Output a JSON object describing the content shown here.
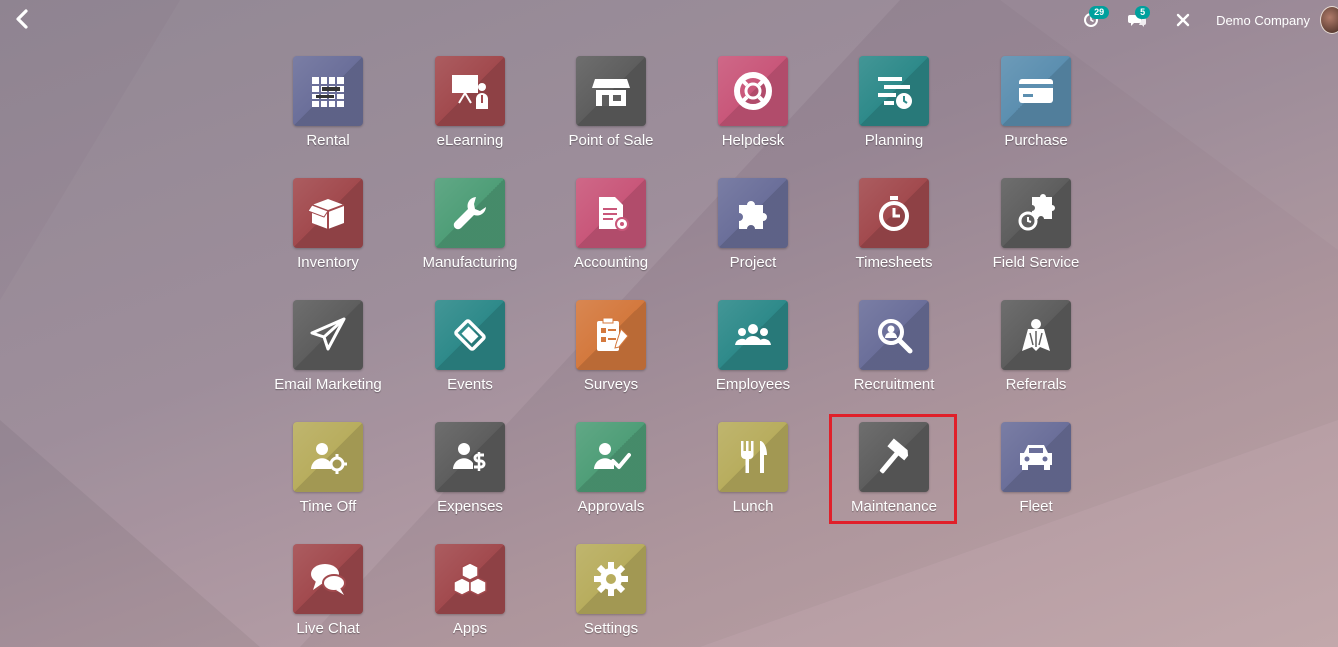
{
  "topbar": {
    "activity_count": "29",
    "messages_count": "5",
    "company_name": "Demo Company"
  },
  "colors": {
    "badge": "#00a09d",
    "highlight": "#e0202a"
  },
  "apps": [
    {
      "label": "Rental",
      "icon": "calendar-grid-icon",
      "color": "#6b6f9a"
    },
    {
      "label": "eLearning",
      "icon": "presentation-icon",
      "color": "#a24a4e"
    },
    {
      "label": "Point of Sale",
      "icon": "store-icon",
      "color": "#5e5e5e"
    },
    {
      "label": "Helpdesk",
      "icon": "lifebuoy-icon",
      "color": "#c9577a"
    },
    {
      "label": "Planning",
      "icon": "planning-icon",
      "color": "#2e8a8a"
    },
    {
      "label": "Purchase",
      "icon": "credit-card-icon",
      "color": "#5c8fb0"
    },
    {
      "label": "Inventory",
      "icon": "box-icon",
      "color": "#a24a4e"
    },
    {
      "label": "Manufacturing",
      "icon": "wrench-icon",
      "color": "#4f9e78"
    },
    {
      "label": "Accounting",
      "icon": "invoice-icon",
      "color": "#c9577a"
    },
    {
      "label": "Project",
      "icon": "puzzle-icon",
      "color": "#6b6f9a"
    },
    {
      "label": "Timesheets",
      "icon": "stopwatch-icon",
      "color": "#a24a4e"
    },
    {
      "label": "Field Service",
      "icon": "field-service-icon",
      "color": "#5e5e5e"
    },
    {
      "label": "Email Marketing",
      "icon": "paper-plane-icon",
      "color": "#5e5e5e"
    },
    {
      "label": "Events",
      "icon": "ticket-icon",
      "color": "#2e8a8a"
    },
    {
      "label": "Surveys",
      "icon": "checklist-icon",
      "color": "#d4793e"
    },
    {
      "label": "Employees",
      "icon": "people-icon",
      "color": "#2e8a8a"
    },
    {
      "label": "Recruitment",
      "icon": "magnifier-icon",
      "color": "#6b6f9a"
    },
    {
      "label": "Referrals",
      "icon": "hero-icon",
      "color": "#5e5e5e"
    },
    {
      "label": "Time Off",
      "icon": "user-gear-icon",
      "color": "#b8ad5e"
    },
    {
      "label": "Expenses",
      "icon": "user-dollar-icon",
      "color": "#5e5e5e"
    },
    {
      "label": "Approvals",
      "icon": "user-check-icon",
      "color": "#4f9e78"
    },
    {
      "label": "Lunch",
      "icon": "cutlery-icon",
      "color": "#b8ad5e"
    },
    {
      "label": "Maintenance",
      "icon": "hammer-icon",
      "color": "#5e5e5e"
    },
    {
      "label": "Fleet",
      "icon": "car-icon",
      "color": "#6b6f9a"
    },
    {
      "label": "Live Chat",
      "icon": "chat-bubbles-icon",
      "color": "#a24a4e"
    },
    {
      "label": "Apps",
      "icon": "cubes-icon",
      "color": "#a24a4e"
    },
    {
      "label": "Settings",
      "icon": "gear-icon",
      "color": "#b8ad5e"
    }
  ]
}
